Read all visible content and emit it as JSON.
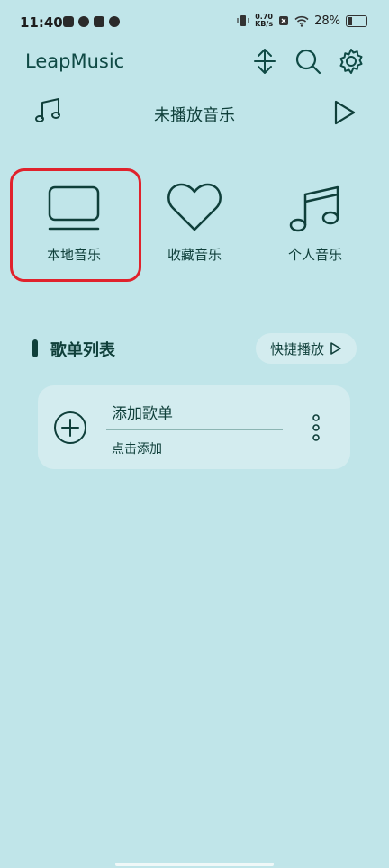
{
  "status_bar": {
    "time": "11:40",
    "network_speed_value": "0.70",
    "network_speed_unit": "KB/s",
    "battery": "28%"
  },
  "header": {
    "app_title": "LeapMusic",
    "icons": [
      "sort-icon",
      "search-icon",
      "gear-icon"
    ]
  },
  "now_playing": {
    "title": "未播放音乐",
    "icons": [
      "music-note-icon",
      "play-icon"
    ]
  },
  "categories": [
    {
      "label": "本地音乐",
      "icon": "monitor-icon",
      "selected": true
    },
    {
      "label": "收藏音乐",
      "icon": "heart-icon"
    },
    {
      "label": "个人音乐",
      "icon": "music-notes-icon"
    }
  ],
  "playlist_section": {
    "title": "歌单列表",
    "quick_play_label": "快捷播放"
  },
  "playlist_card": {
    "title": "添加歌单",
    "subtitle": "点击添加"
  },
  "colors": {
    "background": "#c0e5e9",
    "card": "#d3ecef",
    "primary": "#0f3f3a",
    "highlight": "#e0222c"
  }
}
